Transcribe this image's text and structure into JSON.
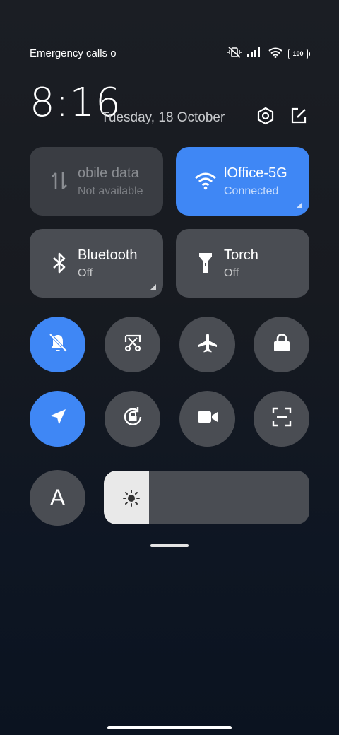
{
  "status_bar": {
    "left_text": "Emergency calls o",
    "battery": "100",
    "icons": [
      "vibrate-off-icon",
      "signal-icon",
      "wifi-icon",
      "battery-icon"
    ]
  },
  "header": {
    "time": "8:16",
    "date": "Tuesday, 18 October",
    "icons": [
      "settings-icon",
      "edit-icon"
    ]
  },
  "tiles": {
    "mobile_data": {
      "title": "obile data",
      "subtitle": "Not available",
      "icon": "mobile-data-icon"
    },
    "wifi": {
      "title": "lOffice-5G",
      "subtitle": "Connected",
      "icon": "wifi-icon"
    },
    "bluetooth": {
      "title": "Bluetooth",
      "subtitle": "Off",
      "icon": "bluetooth-icon"
    },
    "torch": {
      "title": "Torch",
      "subtitle": "Off",
      "icon": "torch-icon"
    }
  },
  "toggles_row1": [
    {
      "name": "mute",
      "icon": "bell-off-icon",
      "active": true
    },
    {
      "name": "screenshot",
      "icon": "scissors-icon",
      "active": false
    },
    {
      "name": "airplane-mode",
      "icon": "airplane-icon",
      "active": false
    },
    {
      "name": "lock-screen",
      "icon": "lock-icon",
      "active": false
    }
  ],
  "toggles_row2": [
    {
      "name": "location",
      "icon": "location-arrow-icon",
      "active": true
    },
    {
      "name": "rotation-lock",
      "icon": "rotation-lock-icon",
      "active": false
    },
    {
      "name": "screen-recorder",
      "icon": "video-camera-icon",
      "active": false
    },
    {
      "name": "scanner",
      "icon": "scan-icon",
      "active": false
    }
  ],
  "bottom": {
    "font_size_label": "A",
    "brightness_level": 0.22,
    "brightness_icon": "sun-icon"
  },
  "colors": {
    "accent": "#3f87f5",
    "tile": "#4a4d53",
    "background": "#1a1d23"
  }
}
